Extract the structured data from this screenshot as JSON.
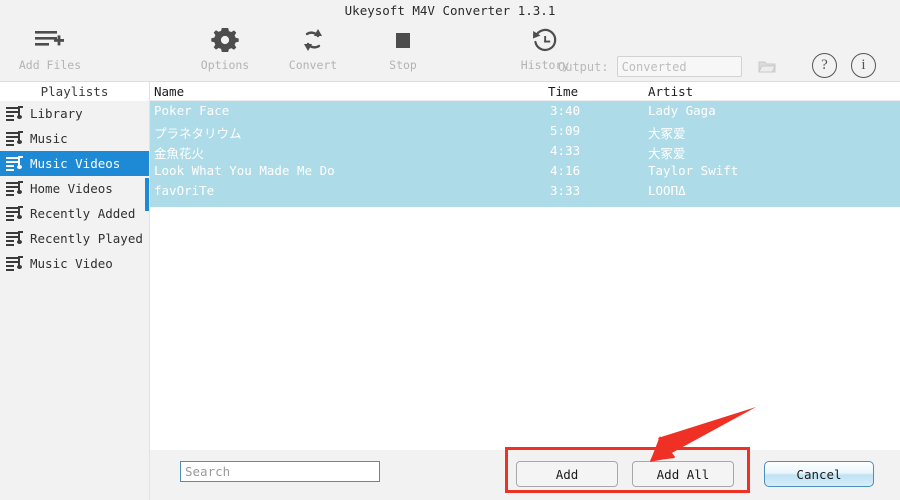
{
  "window": {
    "title": "Ukeysoft M4V Converter 1.3.1"
  },
  "toolbar": {
    "items": [
      {
        "label": "Add Files",
        "icon": "add-files-icon"
      },
      {
        "label": "Options",
        "icon": "gear-icon"
      },
      {
        "label": "Convert",
        "icon": "refresh-icon"
      },
      {
        "label": "Stop",
        "icon": "stop-square-icon"
      },
      {
        "label": "History",
        "icon": "history-clock-icon"
      }
    ],
    "output_label": "Output:",
    "output_value": "",
    "output_placeholder": "Converted",
    "folder_icon": "folder-icon",
    "help_label": "?",
    "info_label": "i"
  },
  "sidebar": {
    "header": "Playlists",
    "items": [
      {
        "label": "Library",
        "selected": false
      },
      {
        "label": "Music",
        "selected": false
      },
      {
        "label": "Music Videos",
        "selected": true
      },
      {
        "label": "Home Videos",
        "selected": false
      },
      {
        "label": "Recently Added",
        "selected": false
      },
      {
        "label": "Recently Played",
        "selected": false
      },
      {
        "label": "Music Video",
        "selected": false
      }
    ]
  },
  "list": {
    "columns": {
      "name": "Name",
      "time": "Time",
      "artist": "Artist"
    },
    "rows": [
      {
        "name": "Poker Face",
        "time": "3:40",
        "artist": "Lady Gaga"
      },
      {
        "name": "プラネタリウム",
        "time": "5:09",
        "artist": "大冢爱"
      },
      {
        "name": "金魚花火",
        "time": "4:33",
        "artist": "大冢爱"
      },
      {
        "name": "Look What You Made Me Do",
        "time": "4:16",
        "artist": "Taylor Swift"
      },
      {
        "name": "favOriTe",
        "time": "3:33",
        "artist": "LOOΠΔ"
      }
    ]
  },
  "bottom": {
    "search_value": "",
    "search_placeholder": "Search",
    "add_label": "Add",
    "add_all_label": "Add All",
    "cancel_label": "Cancel"
  },
  "annotations": {
    "highlight_color": "#ee3124",
    "arrow_target": "add-all-button"
  },
  "colors": {
    "accent_blue": "#1e8ad6",
    "row_highlight": "#aedbe8",
    "toolbar_bg": "#f2f2f2",
    "annotation_red": "#ee3124"
  }
}
